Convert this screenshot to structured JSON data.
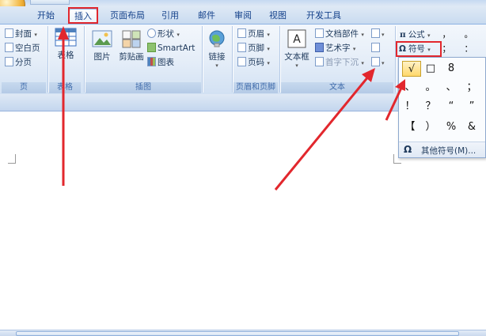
{
  "tabs": [
    "开始",
    "插入",
    "页面布局",
    "引用",
    "邮件",
    "审阅",
    "视图",
    "开发工具"
  ],
  "ribbon": {
    "pages": {
      "cover": "封面",
      "blank": "空白页",
      "break": "分页",
      "label": "页"
    },
    "table": {
      "button": "表格",
      "label": "表格"
    },
    "illustrations": {
      "picture": "图片",
      "clipart": "剪贴画",
      "shapes": "形状",
      "smartart": "SmartArt",
      "chart": "图表",
      "label": "插图"
    },
    "links": {
      "link": "链接"
    },
    "header_footer": {
      "header": "页眉",
      "footer": "页脚",
      "page_number": "页码",
      "label": "页眉和页脚"
    },
    "text": {
      "textbox": "文本框",
      "quick_parts": "文档部件",
      "wordart": "艺术字",
      "dropcap": "首字下沉",
      "label": "文本"
    },
    "symbols": {
      "formula": "公式",
      "symbol": "符号"
    }
  },
  "symbol_row": [
    "，",
    "。",
    "；",
    "："
  ],
  "dropdown": {
    "symbols": [
      "√",
      "□",
      "8",
      "、",
      "。",
      "、",
      "；",
      "！",
      "？",
      "“",
      "”",
      "【",
      "）",
      "%",
      "&"
    ],
    "more_label": "其他符号(M)..."
  },
  "colors": {
    "accent_red": "#e2272d",
    "ribbon_blue": "#d2e1f3"
  }
}
